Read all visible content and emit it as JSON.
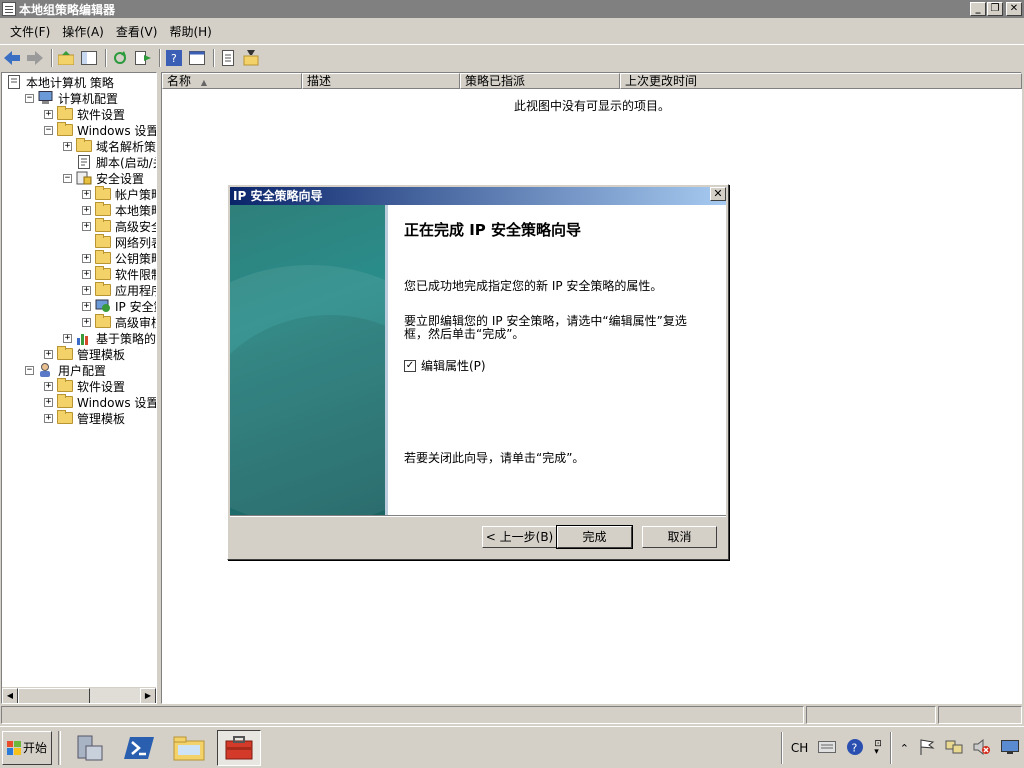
{
  "window": {
    "title": "本地组策略编辑器",
    "minimize": "_",
    "restore": "❐",
    "close": "✕"
  },
  "menu": [
    "文件(F)",
    "操作(A)",
    "查看(V)",
    "帮助(H)"
  ],
  "tree": [
    {
      "label": "本地计算机 策略",
      "level": 0,
      "exp": "",
      "icon": "policy-icon"
    },
    {
      "label": "计算机配置",
      "level": 1,
      "exp": "−",
      "icon": "computer-icon"
    },
    {
      "label": "软件设置",
      "level": 2,
      "exp": "+",
      "icon": "folder-icon"
    },
    {
      "label": "Windows 设置",
      "level": 2,
      "exp": "−",
      "icon": "folder-icon"
    },
    {
      "label": "域名解析策略",
      "level": 3,
      "exp": "+",
      "icon": "folder-icon"
    },
    {
      "label": "脚本(启动/关",
      "level": 3,
      "exp": "",
      "icon": "script-icon"
    },
    {
      "label": "安全设置",
      "level": 3,
      "exp": "−",
      "icon": "security-icon"
    },
    {
      "label": "帐户策略",
      "level": 4,
      "exp": "+",
      "icon": "folder-icon"
    },
    {
      "label": "本地策略",
      "level": 4,
      "exp": "+",
      "icon": "folder-icon"
    },
    {
      "label": "高级安全",
      "level": 4,
      "exp": "+",
      "icon": "folder-icon"
    },
    {
      "label": "网络列表管",
      "level": 4,
      "exp": "",
      "icon": "folder-icon"
    },
    {
      "label": "公钥策略",
      "level": 4,
      "exp": "+",
      "icon": "folder-icon"
    },
    {
      "label": "软件限制策",
      "level": 4,
      "exp": "+",
      "icon": "folder-icon"
    },
    {
      "label": "应用程序控",
      "level": 4,
      "exp": "+",
      "icon": "folder-icon"
    },
    {
      "label": "IP 安全策",
      "level": 4,
      "exp": "+",
      "icon": "ip-security-icon"
    },
    {
      "label": "高级审核策",
      "level": 4,
      "exp": "+",
      "icon": "folder-icon"
    },
    {
      "label": "基于策略的 Q",
      "level": 3,
      "exp": "+",
      "icon": "chart-icon"
    },
    {
      "label": "管理模板",
      "level": 2,
      "exp": "+",
      "icon": "folder-icon"
    },
    {
      "label": "用户配置",
      "level": 1,
      "exp": "−",
      "icon": "user-icon"
    },
    {
      "label": "软件设置",
      "level": 2,
      "exp": "+",
      "icon": "folder-icon"
    },
    {
      "label": "Windows 设置",
      "level": 2,
      "exp": "+",
      "icon": "folder-icon"
    },
    {
      "label": "管理模板",
      "level": 2,
      "exp": "+",
      "icon": "folder-icon"
    }
  ],
  "columns": [
    "名称",
    "描述",
    "策略已指派",
    "上次更改时间"
  ],
  "list_empty": "此视图中没有可显示的项目。",
  "dialog": {
    "title": "IP 安全策略向导",
    "heading": "正在完成 IP 安全策略向导",
    "text1": "您已成功地完成指定您的新 IP 安全策略的属性。",
    "text2": "要立即编辑您的 IP 安全策略，请选中“编辑属性”复选框，然后单击“完成”。",
    "checkbox_label": "编辑属性(P)",
    "checkbox_checked": true,
    "text3": "若要关闭此向导，请单击“完成”。",
    "back": "< 上一步(B)",
    "finish": "完成",
    "cancel": "取消"
  },
  "taskbar": {
    "start": "开始",
    "lang": "CH"
  },
  "colors": {
    "title_inactive": "#808080",
    "dialog_title_start": "#0a246a",
    "dialog_title_end": "#a6caf0",
    "wizard_side": "#2a8d8a"
  }
}
